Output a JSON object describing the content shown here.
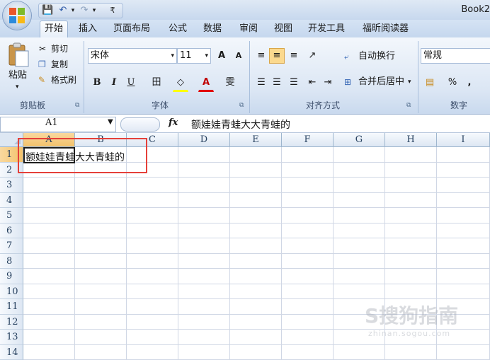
{
  "titlebar": {
    "book_title": "Book2"
  },
  "qat": {
    "save": "💾",
    "undo": "↶",
    "undo_arrow": "▾",
    "redo": "↷",
    "redo_arrow": "▾",
    "customize": "₹"
  },
  "tabs": [
    "开始",
    "插入",
    "页面布局",
    "公式",
    "数据",
    "审阅",
    "视图",
    "开发工具",
    "福昕阅读器"
  ],
  "clipboard": {
    "paste": "粘贴",
    "cut": "剪切",
    "copy": "复制",
    "format_painter": "格式刷",
    "group": "剪贴板"
  },
  "font": {
    "name": "宋体",
    "size": "11",
    "grow": "A",
    "shrink": "A",
    "bold": "B",
    "italic": "I",
    "underline": "U",
    "border": "田",
    "fill": "◇",
    "color": "A",
    "phonetic": "雯",
    "group": "字体"
  },
  "alignment": {
    "wrap": "自动换行",
    "merge": "合并后居中",
    "group": "对齐方式"
  },
  "number": {
    "format": "常规",
    "percent": "%",
    "comma": ",",
    "group": "数字"
  },
  "formula_bar": {
    "name_box": "A1",
    "fx": "fx",
    "content": "额娃娃青蛙大大青蛙的"
  },
  "grid": {
    "columns": [
      "A",
      "B",
      "C",
      "D",
      "E",
      "F",
      "G",
      "H",
      "I"
    ],
    "rows": [
      "1",
      "2",
      "3",
      "4",
      "5",
      "6",
      "7",
      "8",
      "9",
      "10",
      "11",
      "12",
      "13",
      "14"
    ],
    "a1_value": "额娃娃青蛙大大青蛙的",
    "active_cell": "A1"
  },
  "watermark": {
    "brand": "S搜狗指南",
    "url": "zhinan.sogou.com"
  },
  "colors": {
    "accent_selection": "#f3c26b",
    "ribbon_bg": "#dbe6f4",
    "highlight_box": "#e5403a"
  }
}
